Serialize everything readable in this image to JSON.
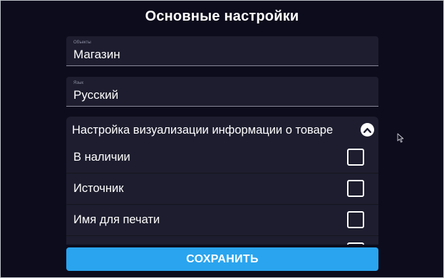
{
  "title": "Основные настройки",
  "fields": {
    "objects": {
      "caption": "Объекты",
      "value": "Магазин"
    },
    "language": {
      "caption": "Язык",
      "value": "Русский"
    }
  },
  "panel": {
    "title": "Настройка визуализации информации о товаре",
    "expanded": true,
    "collapse_icon": "chevron-up-icon",
    "rows": [
      {
        "label": "В наличии",
        "checked": false
      },
      {
        "label": "Источник",
        "checked": false
      },
      {
        "label": "Имя для печати",
        "checked": false
      },
      {
        "label": "",
        "checked": false
      }
    ]
  },
  "save_button": {
    "label": "СОХРАНИТЬ"
  },
  "colors": {
    "background": "#0c0c1c",
    "surface": "#1d1d2f",
    "accent": "#2aa4ee",
    "text": "#ffffff"
  }
}
